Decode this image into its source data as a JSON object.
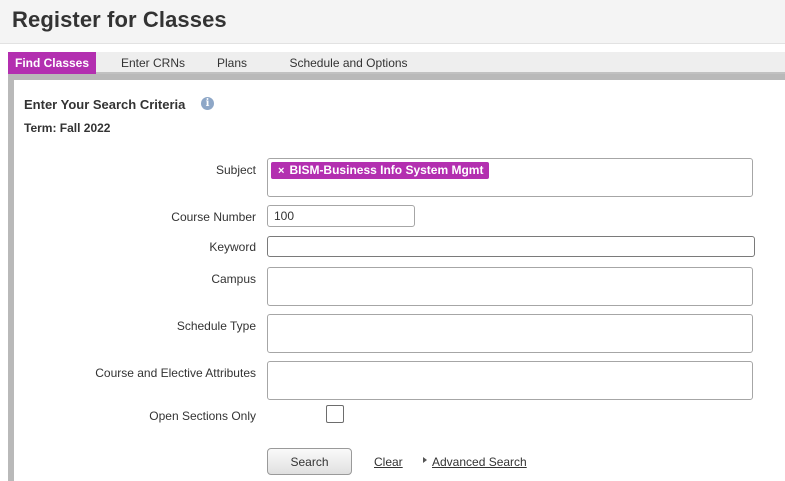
{
  "page": {
    "title": "Register for Classes"
  },
  "tabs": [
    {
      "label": "Find Classes",
      "active": true
    },
    {
      "label": "Enter CRNs",
      "active": false
    },
    {
      "label": "Plans",
      "active": false
    },
    {
      "label": "Schedule and Options",
      "active": false
    }
  ],
  "search": {
    "heading": "Enter Your Search Criteria",
    "info_icon": "info-icon",
    "term": "Term: Fall 2022",
    "fields": {
      "subject": {
        "label": "Subject",
        "chips": [
          {
            "remove": "×",
            "text": "BISM-Business Info System Mgmt"
          }
        ]
      },
      "course_number": {
        "label": "Course Number",
        "value": "100"
      },
      "keyword": {
        "label": "Keyword",
        "value": ""
      },
      "campus": {
        "label": "Campus"
      },
      "schedule_type": {
        "label": "Schedule Type"
      },
      "attributes": {
        "label": "Course and Elective Attributes"
      },
      "open_sections": {
        "label": "Open Sections Only",
        "checked": false
      }
    },
    "actions": {
      "search_label": "Search",
      "clear_label": "Clear",
      "advanced_label": "Advanced Search"
    }
  },
  "colors": {
    "accent": "#b32fb0",
    "header_bg": "#f4f4f4",
    "panel_border": "#b9b9b9"
  }
}
